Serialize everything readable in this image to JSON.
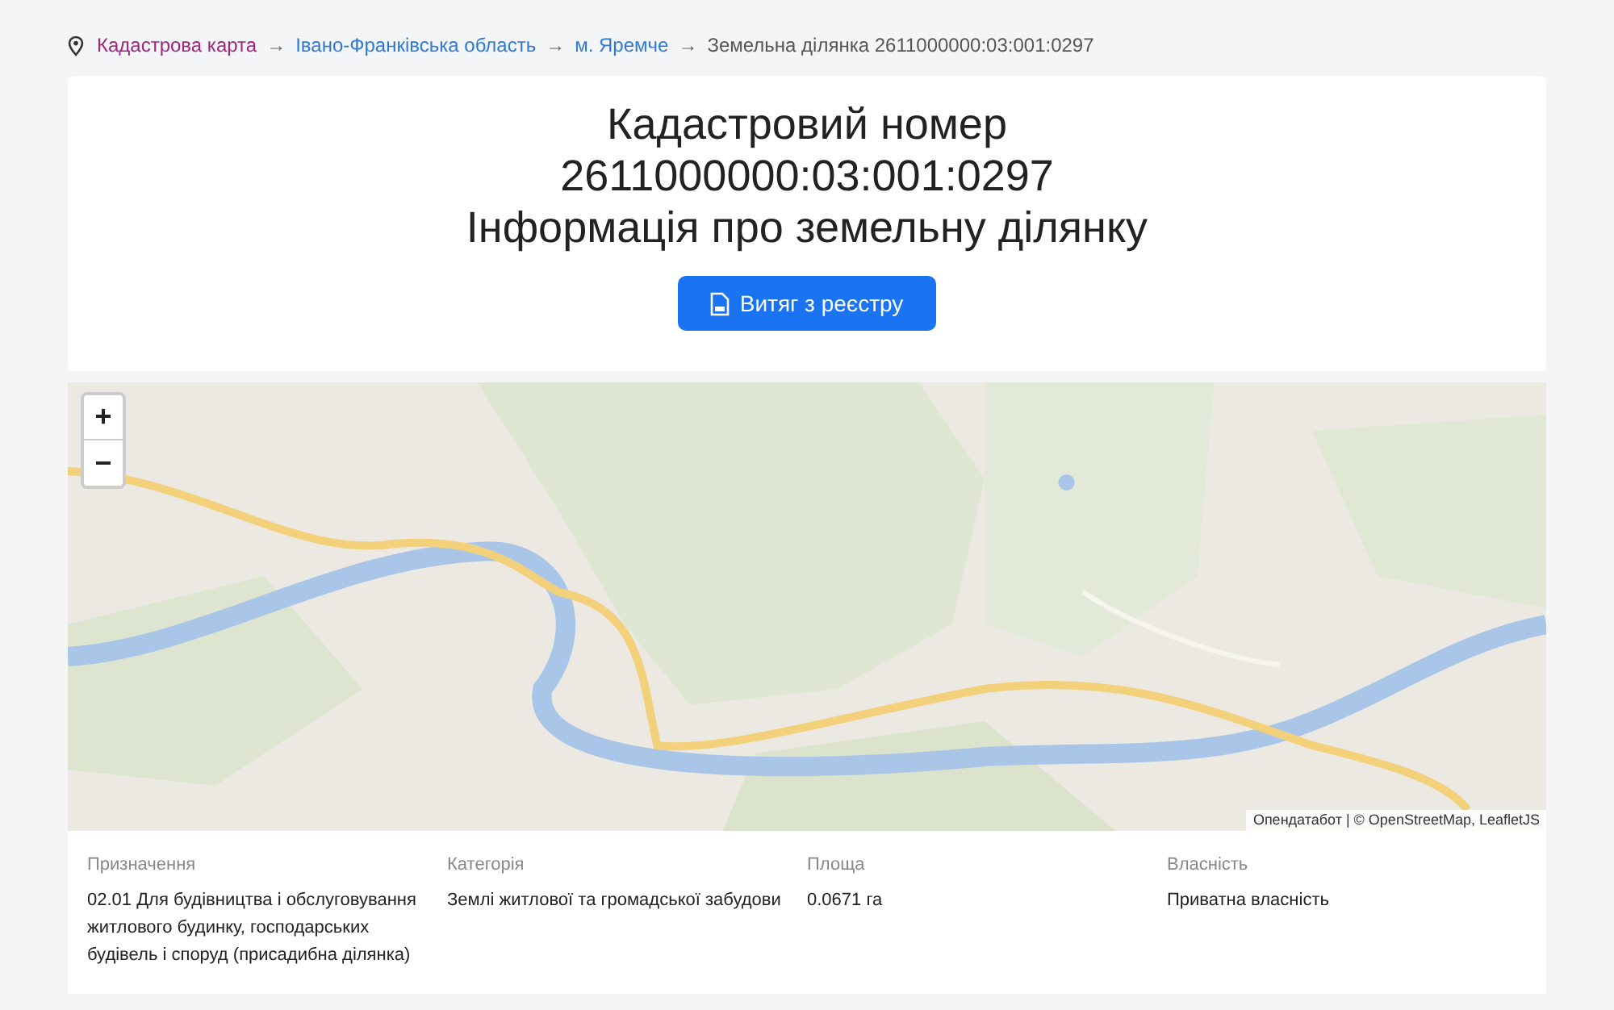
{
  "breadcrumb": [
    {
      "label": "Кадастрова карта",
      "kind": "visited"
    },
    {
      "label": "Івано-Франківська область",
      "kind": "link"
    },
    {
      "label": "м. Яремче",
      "kind": "link"
    },
    {
      "label": "Земельна ділянка 2611000000:03:001:0297",
      "kind": "current"
    }
  ],
  "breadcrumb_separator": "→",
  "header": {
    "title_lines": [
      "Кадастровий номер",
      "2611000000:03:001:0297",
      "Інформація про земельну ділянку"
    ],
    "button": "Витяг з реєстру"
  },
  "map": {
    "zoom_in": "+",
    "zoom_out": "−",
    "attribution": "Опендатабот | © OpenStreetMap, LeafletJS"
  },
  "details": [
    {
      "label": "Призначення",
      "value": "02.01 Для будівництва і обслуговування житлового будинку, господарських будівель і споруд (присадибна ділянка)"
    },
    {
      "label": "Категорія",
      "value": "Землі житлової та громадської забудови"
    },
    {
      "label": "Площа",
      "value": "0.0671 га"
    },
    {
      "label": "Власність",
      "value": "Приватна власність"
    }
  ]
}
